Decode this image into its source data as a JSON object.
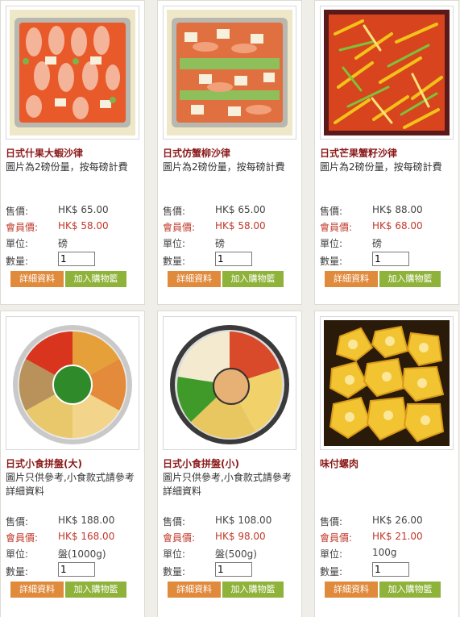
{
  "colors": {
    "name": "#8b1a1a",
    "member_price": "#c0392b",
    "detail_button": "#e08a3c",
    "cart_button": "#8fb23a"
  },
  "labels": {
    "price": "售價:",
    "member_price": "會員價:",
    "unit": "單位:",
    "quantity": "數量:",
    "detail_button": "詳細資料",
    "cart_button": "加入購物籃"
  },
  "products": [
    {
      "name": "日式什果大蝦沙律",
      "desc": "圖片為2磅份量，按每磅計費",
      "price": "HK$ 65.00",
      "member_price": "HK$ 58.00",
      "unit": "磅",
      "qty": "1"
    },
    {
      "name": "日式仿蟹柳沙律",
      "desc": "圖片為2磅份量，按每磅計費",
      "price": "HK$ 65.00",
      "member_price": "HK$ 58.00",
      "unit": "磅",
      "qty": "1"
    },
    {
      "name": "日式芒果蟹籽沙律",
      "desc": "圖片為2磅份量，按每磅計費",
      "price": "HK$ 88.00",
      "member_price": "HK$ 68.00",
      "unit": "磅",
      "qty": "1"
    },
    {
      "name": "日式小食拼盤(大)",
      "desc": "圖片只供參考,小食款式請參考詳細資料",
      "price": "HK$ 188.00",
      "member_price": "HK$ 168.00",
      "unit": "盤(1000g)",
      "qty": "1"
    },
    {
      "name": "日式小食拼盤(小)",
      "desc": "圖片只供參考,小食款式請參考詳細資料",
      "price": "HK$ 108.00",
      "member_price": "HK$ 98.00",
      "unit": "盤(500g)",
      "qty": "1"
    },
    {
      "name": "味付螺肉",
      "desc": "",
      "price": "HK$ 26.00",
      "member_price": "HK$ 21.00",
      "unit": "100g",
      "qty": "1"
    }
  ]
}
